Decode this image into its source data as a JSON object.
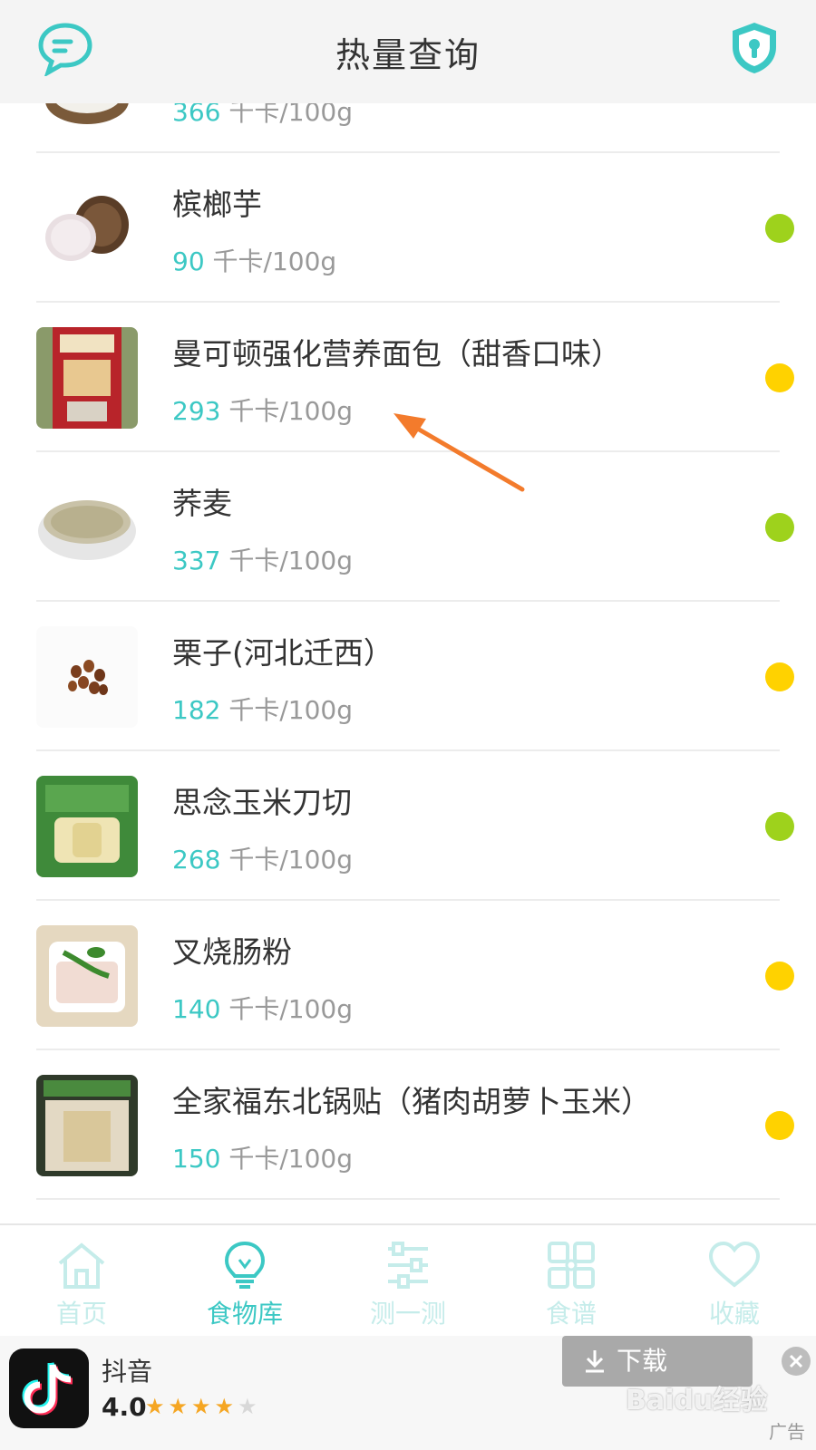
{
  "header": {
    "title": "热量查询",
    "message_icon": "chat-bubble-icon",
    "privacy_icon": "shield-lock-icon",
    "accent": "#3cc8c4"
  },
  "list": {
    "unit": "千卡/100g",
    "items": [
      {
        "name": "",
        "calories": "366",
        "level": "yellow",
        "thumb": "flour-bowl"
      },
      {
        "name": "槟榔芋",
        "calories": "90",
        "level": "green",
        "thumb": "taro"
      },
      {
        "name": "曼可顿强化营养面包（甜香口味）",
        "calories": "293",
        "level": "yellow",
        "thumb": "bread-package"
      },
      {
        "name": "荞麦",
        "calories": "337",
        "level": "green",
        "thumb": "buckwheat-bowl"
      },
      {
        "name": "栗子(河北迁西）",
        "calories": "182",
        "level": "yellow",
        "thumb": "chestnuts"
      },
      {
        "name": "思念玉米刀切",
        "calories": "268",
        "level": "green",
        "thumb": "corn-bun-package"
      },
      {
        "name": "叉烧肠粉",
        "calories": "140",
        "level": "yellow",
        "thumb": "rice-roll"
      },
      {
        "name": "全家福东北锅贴（猪肉胡萝卜玉米）",
        "calories": "150",
        "level": "yellow",
        "thumb": "potsticker-package"
      }
    ],
    "level_colors": {
      "green": "#9ed21c",
      "yellow": "#ffd200"
    }
  },
  "tabbar": {
    "tabs": [
      {
        "label": "首页",
        "icon": "home-icon"
      },
      {
        "label": "食物库",
        "icon": "lightbulb-icon",
        "active": true
      },
      {
        "label": "测一测",
        "icon": "sliders-icon"
      },
      {
        "label": "食谱",
        "icon": "grid-icon"
      },
      {
        "label": "收藏",
        "icon": "heart-icon"
      }
    ]
  },
  "ad": {
    "app_name": "抖音",
    "rating": "4.0",
    "rating_stars": 4,
    "download_label": "下载",
    "ad_tag": "广告",
    "watermark": "Baidu经验",
    "watermark_url": "jingyan.baidu.com"
  }
}
